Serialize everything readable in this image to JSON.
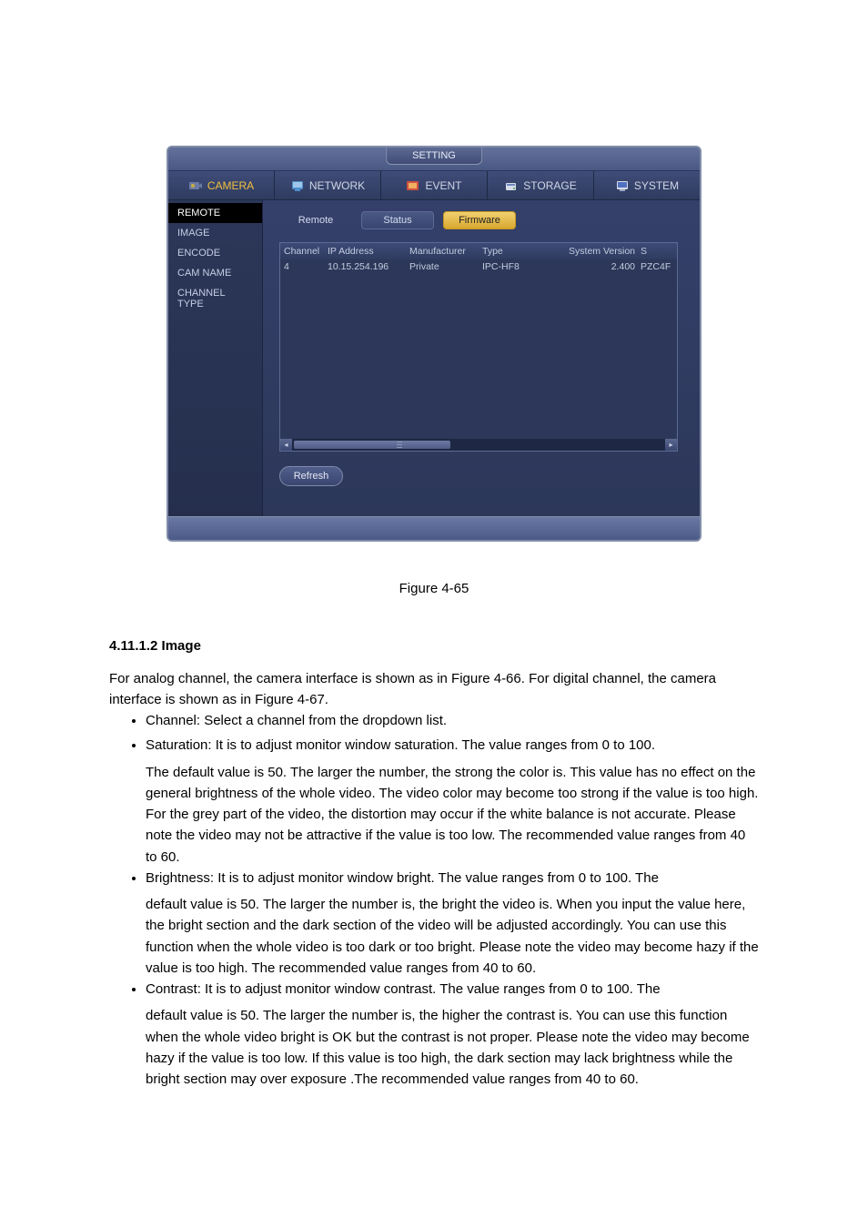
{
  "dialog": {
    "title": "SETTING",
    "topnav": [
      {
        "label": "CAMERA",
        "active": true
      },
      {
        "label": "NETWORK",
        "active": false
      },
      {
        "label": "EVENT",
        "active": false
      },
      {
        "label": "STORAGE",
        "active": false
      },
      {
        "label": "SYSTEM",
        "active": false
      }
    ],
    "sidebar": [
      {
        "label": "REMOTE",
        "active": true
      },
      {
        "label": "IMAGE",
        "active": false
      },
      {
        "label": "ENCODE",
        "active": false
      },
      {
        "label": "CAM NAME",
        "active": false
      },
      {
        "label": "CHANNEL TYPE",
        "active": false
      }
    ],
    "subtabs": [
      {
        "label": "Remote",
        "active": false
      },
      {
        "label": "Status",
        "active": false
      },
      {
        "label": "Firmware",
        "active": true
      }
    ],
    "table": {
      "headers": {
        "channel": "Channel",
        "ip": "IP Address",
        "mfg": "Manufacturer",
        "type": "Type",
        "sv": "System Version",
        "sn": "S"
      },
      "rows": [
        {
          "channel": "4",
          "ip": "10.15.254.196",
          "mfg": "Private",
          "type": "IPC-HF8",
          "sv": "2.400",
          "sn": "PZC4F"
        }
      ]
    },
    "refresh": "Refresh"
  },
  "doc": {
    "figure_label": "Figure 4-65",
    "heading": "4.11.1.2 Image",
    "intro": "For analog channel, the camera interface is shown as in Figure 4-66. For digital channel, the camera interface is shown as in Figure 4-67.",
    "b1_head": "Channel: Select a channel from the dropdown list.",
    "b2_head": "Saturation: It is to adjust monitor window saturation. The value ranges from 0 to 100.",
    "b2_body": "The default value is 50. The larger the number, the strong the color is. This value has no effect on the general brightness of the whole video. The video color may become too strong if the value is too high. For the grey part of the video, the distortion may occur if the white balance is not accurate. Please note the video may not be attractive if the value is too low. The recommended value ranges from 40 to 60.",
    "b3_head": "Brightness: It is to adjust monitor window bright. The value ranges from 0 to 100. The",
    "b3_body": "default value is 50. The larger the number is, the bright the video is. When you input the value here, the bright section and the dark section of the video will be adjusted accordingly. You can use this function when the whole video is too dark or too bright. Please note the video may become hazy if the value is too high. The recommended value ranges from 40 to 60.",
    "b4_head": "Contrast: It is to adjust monitor window contrast. The value ranges from 0 to 100. The",
    "b4_body": "default value is 50. The larger the number is, the higher the contrast is. You can use this function when the whole video bright is OK but the contrast is not proper. Please note the video may become hazy if the value is too low. If this value is too high, the dark section may lack brightness while the bright section may over exposure .The recommended value ranges from 40 to 60."
  }
}
